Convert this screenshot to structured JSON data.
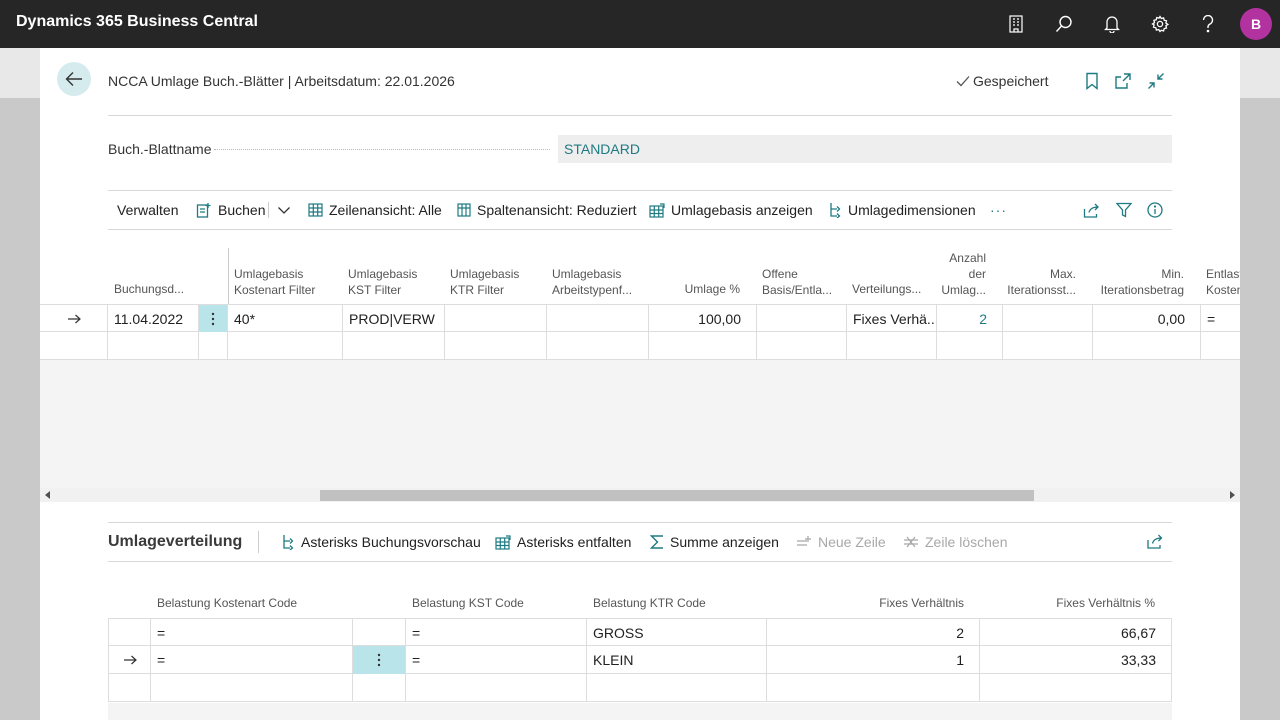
{
  "app": {
    "title": "Dynamics 365 Business Central",
    "user_initial": "B",
    "accent": "#b232a0"
  },
  "topbar_icons": [
    "building-icon",
    "search-icon",
    "bell-icon",
    "gear-icon",
    "help-icon"
  ],
  "header": {
    "title": "NCCA Umlage Buch.-Blätter | Arbeitsdatum: 22.01.2026",
    "saved": "Gespeichert"
  },
  "batch": {
    "label": "Buch.-Blattname",
    "value": "STANDARD"
  },
  "actions": {
    "manage": "Verwalten",
    "post": "Buchen",
    "row_view": "Zeilenansicht: Alle",
    "col_view": "Spaltenansicht: Reduziert",
    "show_basis": "Umlagebasis anzeigen",
    "dimensions": "Umlagedimensionen",
    "more": "···"
  },
  "grid": {
    "columns": {
      "posting_date": "Buchungsd...",
      "cost_type_filter": [
        "Umlagebasis",
        "Kostenart Filter"
      ],
      "cc_filter": [
        "Umlagebasis",
        "KST Filter"
      ],
      "co_filter": [
        "Umlagebasis",
        "KTR Filter"
      ],
      "work_type_filter": [
        "Umlagebasis",
        "Arbeitstypenf..."
      ],
      "alloc_pct": "Umlage %",
      "open_basis": [
        "Offene",
        "Basis/Entla..."
      ],
      "distribution": "Verteilungs...",
      "count": [
        "Anzahl",
        "der",
        "Umlag..."
      ],
      "max_iter": [
        "Max.",
        "Iterationsst..."
      ],
      "min_iter": [
        "Min.",
        "Iterationsbetrag"
      ],
      "relief": [
        "Entlast",
        "Kosten"
      ]
    },
    "rows": [
      {
        "posting_date": "11.04.2022",
        "cost_type_filter": "40*",
        "cc_filter": "PROD|VERW",
        "co_filter": "",
        "work_type_filter": "",
        "alloc_pct": "100,00",
        "open_basis": "",
        "distribution": "Fixes Verhä...",
        "count": "2",
        "max_iter": "",
        "min_iter": "0,00",
        "relief": "="
      }
    ]
  },
  "subpage": {
    "title": "Umlageverteilung",
    "actions": {
      "preview": "Asterisks Buchungsvorschau",
      "expand": "Asterisks entfalten",
      "sum": "Summe anzeigen",
      "new_line": "Neue Zeile",
      "delete_line": "Zeile löschen"
    },
    "columns": {
      "cost_type": "Belastung Kostenart Code",
      "cc": "Belastung KST Code",
      "co": "Belastung KTR Code",
      "ratio": "Fixes Verhältnis",
      "ratio_pct": "Fixes Verhältnis %"
    },
    "rows": [
      {
        "cost_type": "=",
        "cc": "=",
        "co": "GROSS",
        "ratio": "2",
        "ratio_pct": "66,67"
      },
      {
        "cost_type": "=",
        "cc": "=",
        "co": "KLEIN",
        "ratio": "1",
        "ratio_pct": "33,33"
      }
    ]
  }
}
